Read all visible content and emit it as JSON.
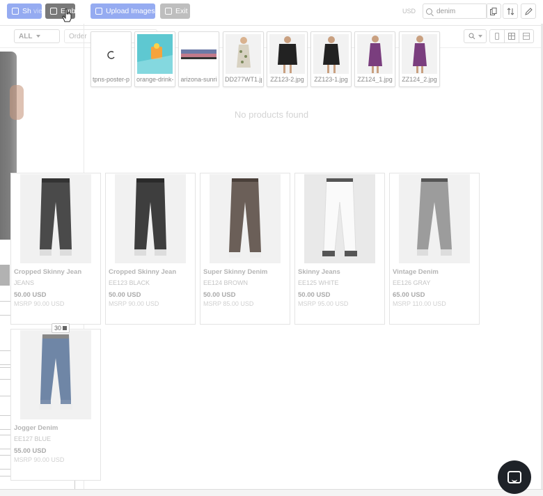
{
  "toolbar": {
    "preview_label": "Sh",
    "preview_ghost": "view",
    "embed_label": "Embed",
    "share_ghost": "are",
    "upload_label": "Upload Images",
    "exit_label": "Exit",
    "currency": "USD",
    "search_value": "denim",
    "icons": [
      "copy-icon",
      "sort-icon",
      "edit-icon"
    ]
  },
  "filters": {
    "category": "ALL",
    "order": "Order"
  },
  "images": [
    {
      "caption": "tpns-poster-p"
    },
    {
      "caption": "orange-drink-"
    },
    {
      "caption": "arizona-sunri"
    },
    {
      "caption": "DD277WT1.jp"
    },
    {
      "caption": "ZZ123-2.jpg"
    },
    {
      "caption": "ZZ123-1.jpg"
    },
    {
      "caption": "ZZ124_1.jpg"
    },
    {
      "caption": "ZZ124_2.jpg"
    }
  ],
  "empty_message": "No products found",
  "products": [
    {
      "name": "Cropped Skinny Jean",
      "sku": "JEANS",
      "price": "50.00 USD",
      "msrp": "MSRP 90.00 USD",
      "color": "#4a4a4a"
    },
    {
      "name": "Cropped Skinny Jean",
      "sku": "EE123 BLACK",
      "price": "50.00 USD",
      "msrp": "MSRP 90.00 USD",
      "color": "#3e3e3e"
    },
    {
      "name": "Super Skinny Denim",
      "sku": "EE124 BROWN",
      "price": "50.00 USD",
      "msrp": "MSRP 85.00 USD",
      "color": "#6b5f58"
    },
    {
      "name": "Skinny Jeans",
      "sku": "EE125 WHITE",
      "price": "50.00 USD",
      "msrp": "MSRP 95.00 USD",
      "color": "#f4f4f4"
    },
    {
      "name": "Vintage Denim",
      "sku": "EE126 GRAY",
      "price": "65.00 USD",
      "msrp": "MSRP 110.00 USD",
      "color": "#9c9c9c"
    },
    {
      "name": "Jogger Denim",
      "sku": "EE127 BLUE",
      "price": "55.00 USD",
      "msrp": "MSRP 90.00 USD",
      "color": "#6f86a6"
    }
  ],
  "count_badge": "30"
}
